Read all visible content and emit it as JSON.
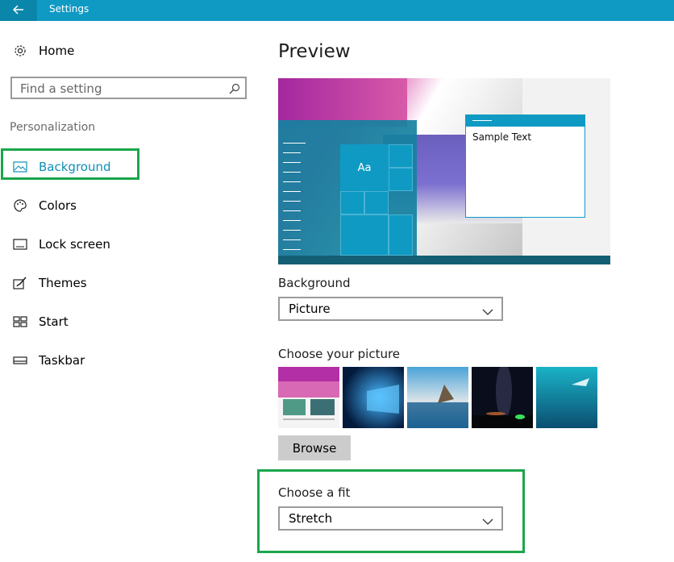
{
  "window": {
    "title": "Settings"
  },
  "sidebar": {
    "home_label": "Home",
    "search_placeholder": "Find a setting",
    "section_label": "Personalization",
    "items": [
      {
        "label": "Background",
        "icon": "picture-icon",
        "selected": true
      },
      {
        "label": "Colors",
        "icon": "palette-icon"
      },
      {
        "label": "Lock screen",
        "icon": "lock-screen-icon"
      },
      {
        "label": "Themes",
        "icon": "brush-icon"
      },
      {
        "label": "Start",
        "icon": "start-tiles-icon"
      },
      {
        "label": "Taskbar",
        "icon": "taskbar-icon"
      }
    ]
  },
  "main": {
    "preview_heading": "Preview",
    "preview_sample_text": "Sample Text",
    "preview_tile_text": "Aa",
    "background_label": "Background",
    "background_value": "Picture",
    "choose_picture_label": "Choose your picture",
    "browse_label": "Browse",
    "fit_label": "Choose a fit",
    "fit_value": "Stretch"
  },
  "colors": {
    "accent": "#0f9ac4",
    "highlight": "#1aa64a",
    "selected_text": "#0f8fb5"
  }
}
